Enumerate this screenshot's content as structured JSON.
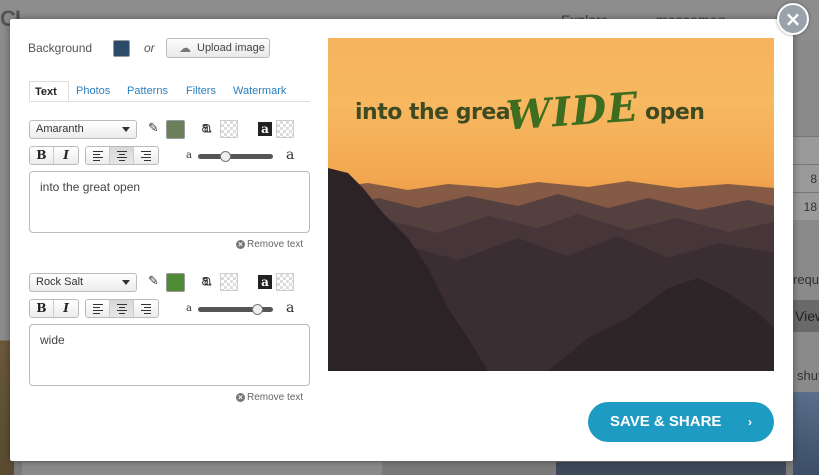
{
  "background_page": {
    "logo": "CL",
    "nav": [
      "Explore",
      "mosaamog"
    ],
    "table_values": [
      "",
      "8",
      "18"
    ],
    "side_text_1": "requi",
    "side_button": "View",
    "side_text_2": "shut"
  },
  "modal": {
    "close_label": "×",
    "background_label": "Background",
    "background_color": "#2c4a6a",
    "or_label": "or",
    "upload_label": "Upload image",
    "tabs": [
      "Text",
      "Photos",
      "Patterns",
      "Filters",
      "Watermark"
    ],
    "active_tab": "Text",
    "text_layers": [
      {
        "font": "Amaranth",
        "color": "#6a7f5a",
        "text": "into the great                    open",
        "remove_label": "Remove text",
        "size_level": 0.35
      },
      {
        "font": "Rock Salt",
        "color": "#4f8a35",
        "text": "wide",
        "remove_label": "Remove text",
        "size_level": 0.85
      }
    ],
    "format_buttons": {
      "bold": "B",
      "italic": "I"
    },
    "slider_small": "a",
    "slider_large": "a",
    "glyph": "a",
    "canvas": {
      "line_part1": "into the great",
      "line_part2": "WIDE",
      "line_part3": "open"
    },
    "share_label": "SAVE & SHARE",
    "share_arrow": "›"
  }
}
